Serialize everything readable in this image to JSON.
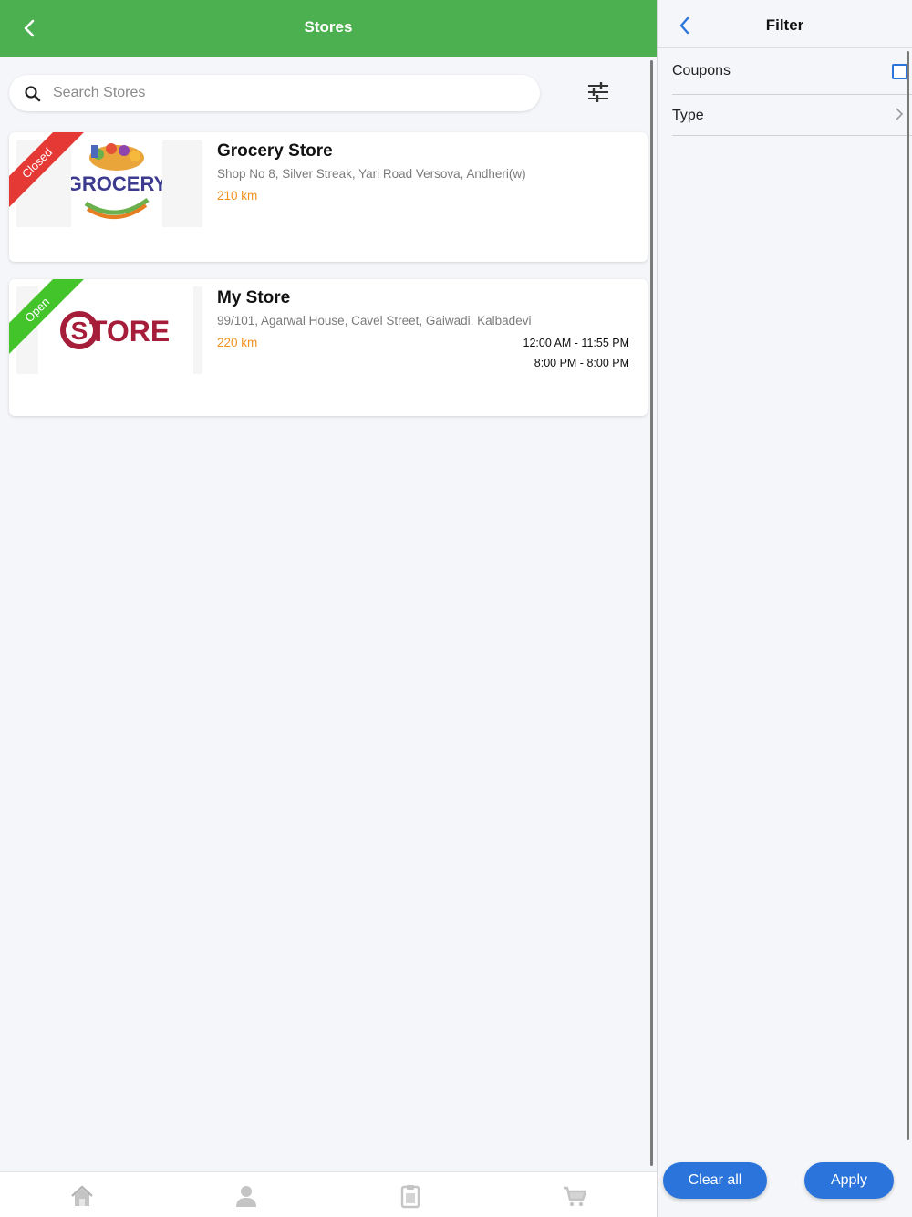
{
  "header": {
    "title": "Stores"
  },
  "search": {
    "placeholder": "Search Stores"
  },
  "stores": [
    {
      "status": "Closed",
      "status_color": "#e53935",
      "name": "Grocery Store",
      "address": "Shop No 8, Silver Streak, Yari Road Versova, Andheri(w)",
      "distance": "210 km",
      "logo_text": "GROCERY",
      "hours": []
    },
    {
      "status": "Open",
      "status_color": "#43c42a",
      "name": "My Store",
      "address": "99/101, Agarwal House, Cavel Street, Gaiwadi, Kalbadevi",
      "distance": "220 km",
      "logo_text": "STORE",
      "hours": [
        "12:00 AM - 11:55 PM",
        "8:00 PM - 8:00 PM"
      ]
    }
  ],
  "tabs": [
    "home-icon",
    "profile-icon",
    "orders-icon",
    "cart-icon"
  ],
  "filter": {
    "title": "Filter",
    "rows": [
      {
        "label": "Coupons",
        "control": "checkbox",
        "checked": false
      },
      {
        "label": "Type",
        "control": "chevron"
      }
    ],
    "clear_label": "Clear all",
    "apply_label": "Apply"
  },
  "colors": {
    "header_green": "#4caf50",
    "accent_blue": "#2a74db",
    "distance_orange": "#f0901d"
  }
}
